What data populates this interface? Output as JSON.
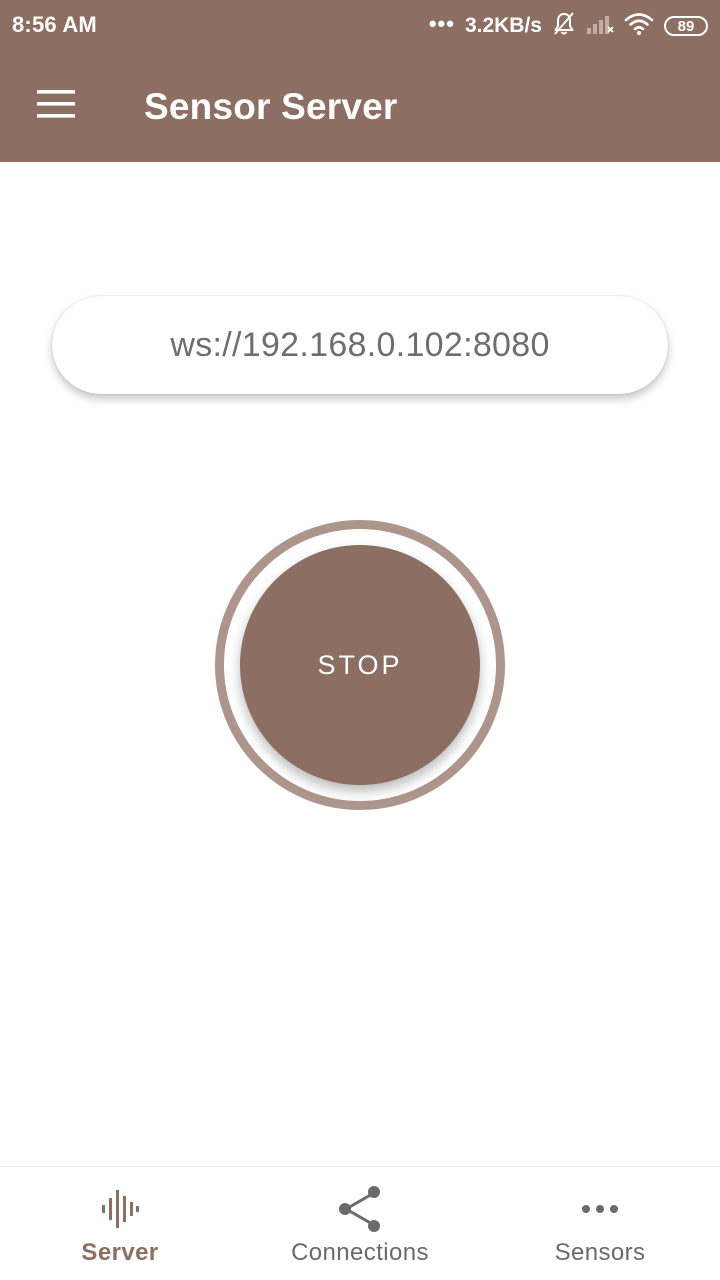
{
  "status_bar": {
    "time": "8:56 AM",
    "dots": "•••",
    "network_speed": "3.2KB/s",
    "battery_level": "89"
  },
  "app_bar": {
    "title": "Sensor Server"
  },
  "server": {
    "url": "ws://192.168.0.102:8080",
    "stop_label": "STOP"
  },
  "bottom_nav": {
    "items": [
      {
        "label": "Server",
        "icon": "sound-wave-icon",
        "active": true
      },
      {
        "label": "Connections",
        "icon": "share-nodes-icon",
        "active": false
      },
      {
        "label": "Sensors",
        "icon": "more-horizontal-icon",
        "active": false
      }
    ]
  },
  "colors": {
    "primary": "#8c6e62",
    "ring": "#ad958c",
    "nav_inactive": "#6a6a6a",
    "url_text": "#6e6e6e"
  }
}
